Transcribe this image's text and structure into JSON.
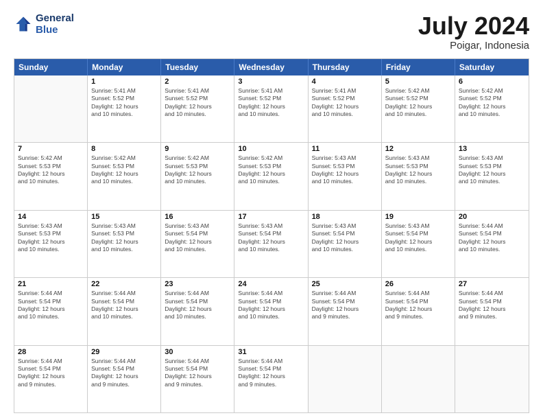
{
  "header": {
    "logo_line1": "General",
    "logo_line2": "Blue",
    "main_title": "July 2024",
    "subtitle": "Poigar, Indonesia"
  },
  "weekdays": [
    "Sunday",
    "Monday",
    "Tuesday",
    "Wednesday",
    "Thursday",
    "Friday",
    "Saturday"
  ],
  "weeks": [
    [
      {
        "day": "",
        "info": ""
      },
      {
        "day": "1",
        "info": "Sunrise: 5:41 AM\nSunset: 5:52 PM\nDaylight: 12 hours\nand 10 minutes."
      },
      {
        "day": "2",
        "info": "Sunrise: 5:41 AM\nSunset: 5:52 PM\nDaylight: 12 hours\nand 10 minutes."
      },
      {
        "day": "3",
        "info": "Sunrise: 5:41 AM\nSunset: 5:52 PM\nDaylight: 12 hours\nand 10 minutes."
      },
      {
        "day": "4",
        "info": "Sunrise: 5:41 AM\nSunset: 5:52 PM\nDaylight: 12 hours\nand 10 minutes."
      },
      {
        "day": "5",
        "info": "Sunrise: 5:42 AM\nSunset: 5:52 PM\nDaylight: 12 hours\nand 10 minutes."
      },
      {
        "day": "6",
        "info": "Sunrise: 5:42 AM\nSunset: 5:52 PM\nDaylight: 12 hours\nand 10 minutes."
      }
    ],
    [
      {
        "day": "7",
        "info": "Sunrise: 5:42 AM\nSunset: 5:53 PM\nDaylight: 12 hours\nand 10 minutes."
      },
      {
        "day": "8",
        "info": "Sunrise: 5:42 AM\nSunset: 5:53 PM\nDaylight: 12 hours\nand 10 minutes."
      },
      {
        "day": "9",
        "info": "Sunrise: 5:42 AM\nSunset: 5:53 PM\nDaylight: 12 hours\nand 10 minutes."
      },
      {
        "day": "10",
        "info": "Sunrise: 5:42 AM\nSunset: 5:53 PM\nDaylight: 12 hours\nand 10 minutes."
      },
      {
        "day": "11",
        "info": "Sunrise: 5:43 AM\nSunset: 5:53 PM\nDaylight: 12 hours\nand 10 minutes."
      },
      {
        "day": "12",
        "info": "Sunrise: 5:43 AM\nSunset: 5:53 PM\nDaylight: 12 hours\nand 10 minutes."
      },
      {
        "day": "13",
        "info": "Sunrise: 5:43 AM\nSunset: 5:53 PM\nDaylight: 12 hours\nand 10 minutes."
      }
    ],
    [
      {
        "day": "14",
        "info": "Sunrise: 5:43 AM\nSunset: 5:53 PM\nDaylight: 12 hours\nand 10 minutes."
      },
      {
        "day": "15",
        "info": "Sunrise: 5:43 AM\nSunset: 5:53 PM\nDaylight: 12 hours\nand 10 minutes."
      },
      {
        "day": "16",
        "info": "Sunrise: 5:43 AM\nSunset: 5:54 PM\nDaylight: 12 hours\nand 10 minutes."
      },
      {
        "day": "17",
        "info": "Sunrise: 5:43 AM\nSunset: 5:54 PM\nDaylight: 12 hours\nand 10 minutes."
      },
      {
        "day": "18",
        "info": "Sunrise: 5:43 AM\nSunset: 5:54 PM\nDaylight: 12 hours\nand 10 minutes."
      },
      {
        "day": "19",
        "info": "Sunrise: 5:43 AM\nSunset: 5:54 PM\nDaylight: 12 hours\nand 10 minutes."
      },
      {
        "day": "20",
        "info": "Sunrise: 5:44 AM\nSunset: 5:54 PM\nDaylight: 12 hours\nand 10 minutes."
      }
    ],
    [
      {
        "day": "21",
        "info": "Sunrise: 5:44 AM\nSunset: 5:54 PM\nDaylight: 12 hours\nand 10 minutes."
      },
      {
        "day": "22",
        "info": "Sunrise: 5:44 AM\nSunset: 5:54 PM\nDaylight: 12 hours\nand 10 minutes."
      },
      {
        "day": "23",
        "info": "Sunrise: 5:44 AM\nSunset: 5:54 PM\nDaylight: 12 hours\nand 10 minutes."
      },
      {
        "day": "24",
        "info": "Sunrise: 5:44 AM\nSunset: 5:54 PM\nDaylight: 12 hours\nand 10 minutes."
      },
      {
        "day": "25",
        "info": "Sunrise: 5:44 AM\nSunset: 5:54 PM\nDaylight: 12 hours\nand 9 minutes."
      },
      {
        "day": "26",
        "info": "Sunrise: 5:44 AM\nSunset: 5:54 PM\nDaylight: 12 hours\nand 9 minutes."
      },
      {
        "day": "27",
        "info": "Sunrise: 5:44 AM\nSunset: 5:54 PM\nDaylight: 12 hours\nand 9 minutes."
      }
    ],
    [
      {
        "day": "28",
        "info": "Sunrise: 5:44 AM\nSunset: 5:54 PM\nDaylight: 12 hours\nand 9 minutes."
      },
      {
        "day": "29",
        "info": "Sunrise: 5:44 AM\nSunset: 5:54 PM\nDaylight: 12 hours\nand 9 minutes."
      },
      {
        "day": "30",
        "info": "Sunrise: 5:44 AM\nSunset: 5:54 PM\nDaylight: 12 hours\nand 9 minutes."
      },
      {
        "day": "31",
        "info": "Sunrise: 5:44 AM\nSunset: 5:54 PM\nDaylight: 12 hours\nand 9 minutes."
      },
      {
        "day": "",
        "info": ""
      },
      {
        "day": "",
        "info": ""
      },
      {
        "day": "",
        "info": ""
      }
    ]
  ]
}
